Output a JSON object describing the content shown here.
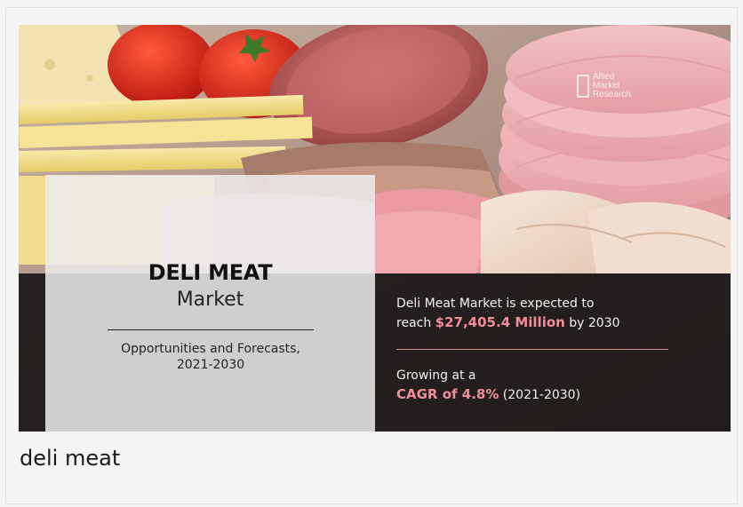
{
  "banner": {
    "title_bold": "DELI MEAT",
    "title_regular": "Market",
    "subtitle_line1": "Opportunities and Forecasts,",
    "subtitle_line2": "2021-2030",
    "stat1_line1": "Deli Meat Market is expected to",
    "stat1_prefix": "reach ",
    "stat1_value": "$27,405.4 Million",
    "stat1_suffix": " by 2030",
    "stat2_line1": "Growing at a",
    "stat2_value": "CAGR of 4.8%",
    "stat2_suffix": " (2021-2030)",
    "logo_line1": "Allied",
    "logo_line2": "Market",
    "logo_line3": "Research"
  },
  "caption": "deli meat",
  "colors": {
    "highlight": "#f08d98",
    "dark_band": "#161414",
    "card_bg": "#f5f5f5"
  }
}
